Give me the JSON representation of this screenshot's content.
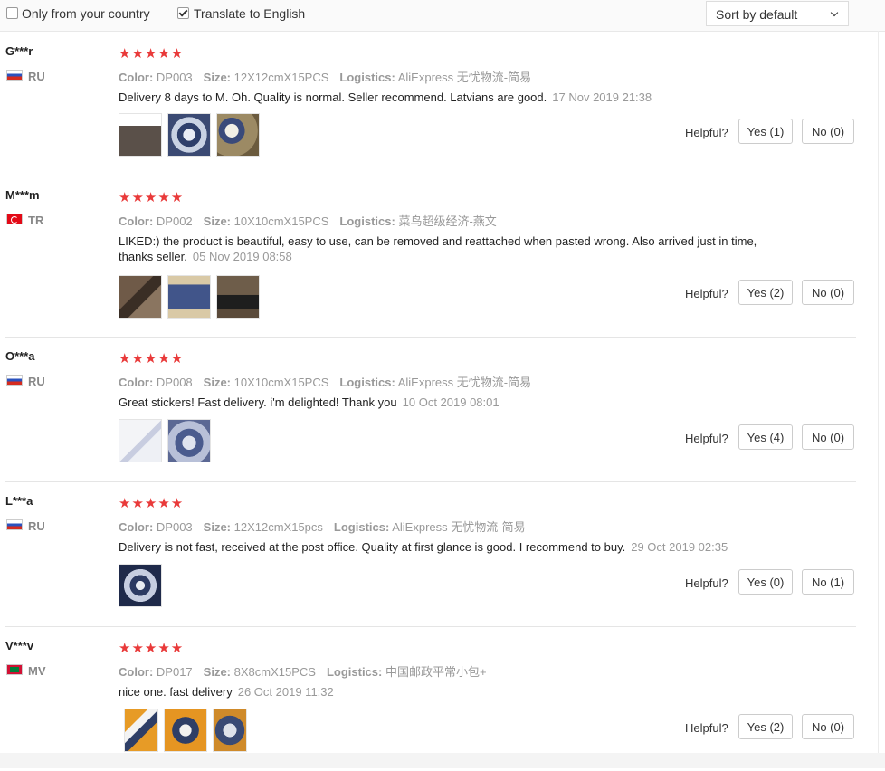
{
  "filters": {
    "only_country_label": "Only from your country",
    "only_country_checked": false,
    "translate_label": "Translate to English",
    "translate_checked": true,
    "sort_value": "Sort by default"
  },
  "reviews": [
    {
      "user": "G***r",
      "country": "RU",
      "stars": "★★★★★",
      "color_label": "Color:",
      "color": "DP003",
      "size_label": "Size:",
      "size": "12X12cmX15PCS",
      "logistics_label": "Logistics:",
      "logistics": "AliExpress 无忧物流-简易",
      "text": "Delivery 8 days to M. Oh. Quality is normal. Seller recommend. Latvians are good.",
      "date": "17 Nov 2019 21:38",
      "helpful_label": "Helpful?",
      "yes": "Yes (1)",
      "no": "No (0)"
    },
    {
      "user": "M***m",
      "country": "TR",
      "stars": "★★★★★",
      "color_label": "Color:",
      "color": "DP002",
      "size_label": "Size:",
      "size": "10X10cmX15PCS",
      "logistics_label": "Logistics:",
      "logistics": "菜鸟超级经济-燕文",
      "text": "LIKED:) the product is beautiful, easy to use, can be removed and reattached when pasted wrong. Also arrived just in time, thanks seller.",
      "date": "05 Nov 2019 08:58",
      "helpful_label": "Helpful?",
      "yes": "Yes (2)",
      "no": "No (0)"
    },
    {
      "user": "O***a",
      "country": "RU",
      "stars": "★★★★★",
      "color_label": "Color:",
      "color": "DP008",
      "size_label": "Size:",
      "size": "10X10cmX15PCS",
      "logistics_label": "Logistics:",
      "logistics": "AliExpress 无忧物流-简易",
      "text": "Great stickers! Fast delivery. i'm delighted! Thank you",
      "date": "10 Oct 2019 08:01",
      "helpful_label": "Helpful?",
      "yes": "Yes (4)",
      "no": "No (0)"
    },
    {
      "user": "L***a",
      "country": "RU",
      "stars": "★★★★★",
      "color_label": "Color:",
      "color": "DP003",
      "size_label": "Size:",
      "size": "12X12cmX15pcs",
      "logistics_label": "Logistics:",
      "logistics": "AliExpress 无忧物流-简易",
      "text": "Delivery is not fast, received at the post office. Quality at first glance is good. I recommend to buy.",
      "date": "29 Oct 2019 02:35",
      "helpful_label": "Helpful?",
      "yes": "Yes (0)",
      "no": "No (1)"
    },
    {
      "user": "V***v",
      "country": "MV",
      "stars": "★★★★★",
      "color_label": "Color:",
      "color": "DP017",
      "size_label": "Size:",
      "size": "8X8cmX15PCS",
      "logistics_label": "Logistics:",
      "logistics": "中国邮政平常小包+",
      "text": "nice one. fast delivery",
      "date": "26 Oct 2019 11:32",
      "helpful_label": "Helpful?",
      "yes": "Yes (2)",
      "no": "No (0)"
    }
  ]
}
